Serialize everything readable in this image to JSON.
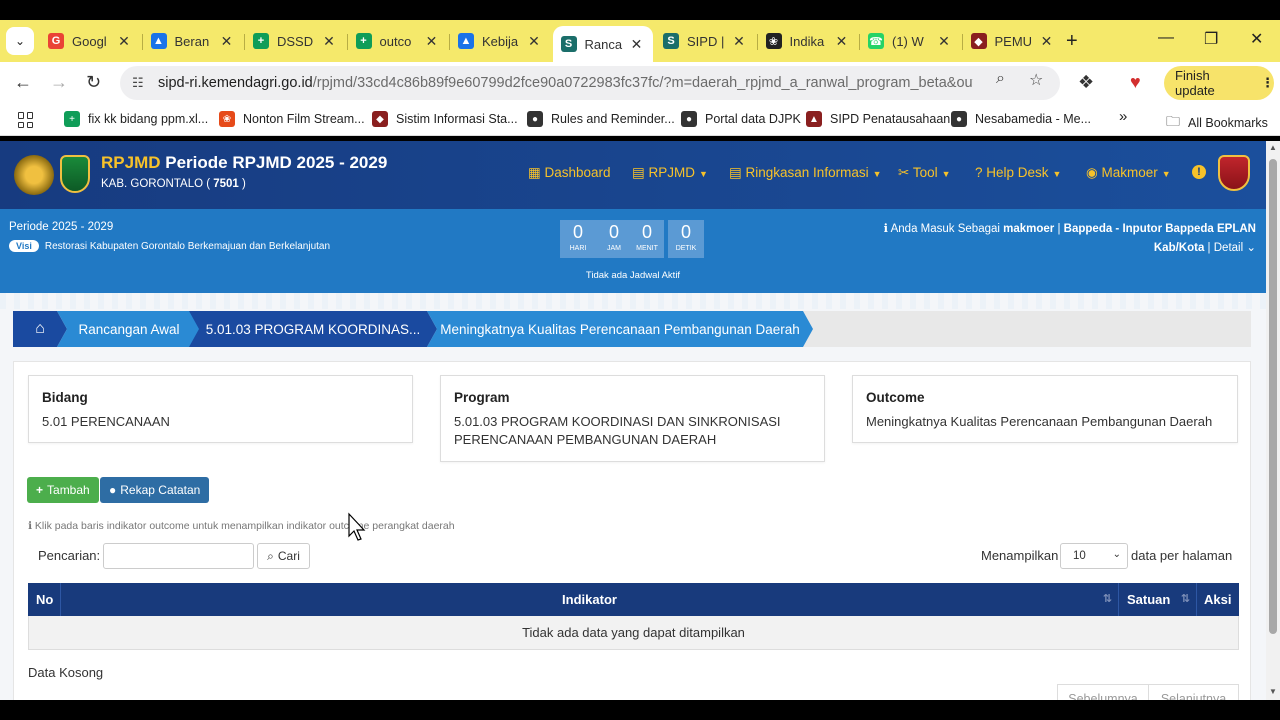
{
  "browser": {
    "tabs": [
      {
        "label": "Googl",
        "icon": "google-icon",
        "color": "#ea4335"
      },
      {
        "label": "Beran",
        "icon": "drive-icon",
        "color": "#1a73e8"
      },
      {
        "label": "DSSD",
        "icon": "sheets-icon",
        "color": "#0f9d58"
      },
      {
        "label": "outco",
        "icon": "sheets-icon",
        "color": "#0f9d58"
      },
      {
        "label": "Kebija",
        "icon": "drive-icon",
        "color": "#1a73e8"
      },
      {
        "label": "Ranca",
        "icon": "sipd-icon",
        "color": "#1b6e6a"
      },
      {
        "label": "SIPD |",
        "icon": "sipd-icon",
        "color": "#1b6e6a"
      },
      {
        "label": "Indika",
        "icon": "chatgpt-icon",
        "color": "#222222"
      },
      {
        "label": "(1) W",
        "icon": "whatsapp-icon",
        "color": "#25d366"
      },
      {
        "label": "PEMU",
        "icon": "shield-icon",
        "color": "#8a1f1f"
      }
    ],
    "active_tab_index": 5,
    "new_tab_symbol": "+",
    "url_host": "sipd-ri.kemendagri.go.id",
    "url_path": "/rpjmd/33cd4c86b89f9e60799d2fce90a0722983fc37fc/?m=daerah_rpjmd_a_ranwal_program_beta&outcom...",
    "finish_update_label": "Finish update",
    "bookmarks": [
      {
        "label": "fix kk bidang ppm.xl...",
        "icon": "sheets-icon",
        "color": "#0f9d58"
      },
      {
        "label": "Nonton Film Stream...",
        "icon": "pinwheel-icon",
        "color": "#e64a19"
      },
      {
        "label": "Sistim Informasi Sta...",
        "icon": "shield-icon",
        "color": "#8a1f1f"
      },
      {
        "label": "Rules and Reminder...",
        "icon": "globe-icon",
        "color": "#333333"
      },
      {
        "label": "Portal data DJPK",
        "icon": "globe-icon",
        "color": "#333333"
      },
      {
        "label": "SIPD Penatausahaan",
        "icon": "sipd-icon",
        "color": "#8a1f1f"
      },
      {
        "label": "Nesabamedia - Me...",
        "icon": "globe-icon",
        "color": "#333333"
      }
    ],
    "bookmarks_more": "»",
    "all_bookmarks_label": "All Bookmarks"
  },
  "app": {
    "title_brand": "RPJMD",
    "title_rest": " Periode RPJMD 2025 - 2029",
    "subtitle_prefix": "KAB. GORONTALO ( ",
    "subtitle_code": "7501",
    "subtitle_suffix": " )",
    "menu": [
      {
        "label": "Dashboard",
        "icon": "dashboard-icon",
        "caret": false
      },
      {
        "label": "RPJMD",
        "icon": "book-icon",
        "caret": true
      },
      {
        "label": "Ringkasan Informasi",
        "icon": "book-icon",
        "caret": true
      },
      {
        "label": "Tool",
        "icon": "scissors-icon",
        "caret": true
      },
      {
        "label": "Help Desk",
        "icon": "question-icon",
        "caret": true
      },
      {
        "label": "Makmoer",
        "icon": "user-icon",
        "caret": true
      }
    ],
    "warning_symbol": "!"
  },
  "infobar": {
    "periode": "Periode 2025 - 2029",
    "visi_badge": "Visi",
    "visi_text": "Restorasi Kabupaten Gorontalo Berkemajuan dan Berkelanjutan",
    "countdown": [
      {
        "value": "0",
        "label": "HARI"
      },
      {
        "value": "0",
        "label": "JAM"
      },
      {
        "value": "0",
        "label": "MENIT"
      },
      {
        "value": "0",
        "label": "DETIK"
      }
    ],
    "jadwal_text": "Tidak ada Jadwal Aktif",
    "login_prefix": "Anda Masuk Sebagai ",
    "login_user": "makmoer",
    "login_sep": " | ",
    "login_role": "Bappeda - Inputor Bappeda EPLAN",
    "kab_label": "Kab/Kota",
    "kab_sep": " | ",
    "detail_label": "Detail"
  },
  "breadcrumb": [
    {
      "label": "",
      "icon": "home-icon",
      "color": "#1a4aa0"
    },
    {
      "label": "Rancangan Awal",
      "color": "#2a8ad4"
    },
    {
      "label": "5.01.03 PROGRAM KOORDINAS...",
      "color": "#1a4aa0"
    },
    {
      "label": "Meningkatnya Kualitas Perencanaan Pembangunan Daerah",
      "color": "#2a8ad4"
    }
  ],
  "info_boxes": [
    {
      "title": "Bidang",
      "value": "5.01 PERENCANAAN"
    },
    {
      "title": "Program",
      "value": "5.01.03 PROGRAM KOORDINASI DAN SINKRONISASI PERENCANAAN PEMBANGUNAN DAERAH"
    },
    {
      "title": "Outcome",
      "value": "Meningkatnya Kualitas Perencanaan Pembangunan Daerah"
    }
  ],
  "actions": {
    "tambah_label": "Tambah",
    "rekap_label": "Rekap Catatan"
  },
  "hint": "Klik pada baris indikator outcome untuk menampilkan indikator outcome perangkat daerah",
  "search": {
    "label": "Pencarian:",
    "value": "",
    "button_label": "Cari"
  },
  "page_size": {
    "prefix": "Menampilkan",
    "value": "10",
    "suffix": "data per halaman"
  },
  "table": {
    "columns": [
      "No",
      "Indikator",
      "Satuan",
      "Aksi"
    ],
    "empty_text": "Tidak ada data yang dapat ditampilkan"
  },
  "data_kosong": "Data Kosong",
  "pagination": {
    "prev": "Sebelumnya",
    "next": "Selanjutnya"
  },
  "colors": {
    "tabstrip": "#f5e96b",
    "header_navy": "#173b80",
    "info_blue": "#2179c4",
    "accent_gold": "#f7c22a",
    "btn_green": "#4cae4c",
    "btn_blue": "#2e6da4",
    "table_head": "#183a7c"
  }
}
